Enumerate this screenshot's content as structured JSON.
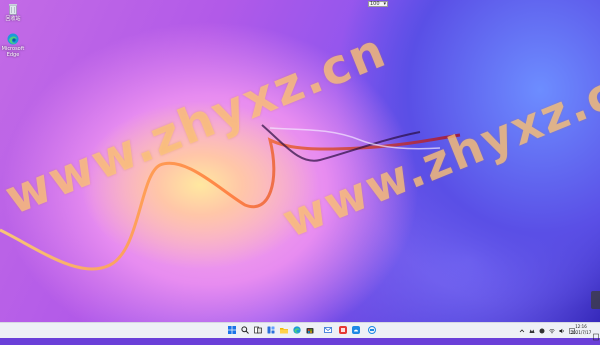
{
  "desktop": {
    "icons": [
      {
        "label": "回收站",
        "icon": "recycle-bin-icon"
      },
      {
        "label": "Microsoft Edge",
        "icon": "edge-icon"
      }
    ],
    "watermarks": [
      "www.zhyxz.cn",
      "www.zhyxz.cn"
    ]
  },
  "top_widget": {
    "value": "100"
  },
  "taskbar": {
    "apps": [
      {
        "name": "start-icon",
        "color": "#1a73e8"
      },
      {
        "name": "search-icon",
        "color": "#222222"
      },
      {
        "name": "task-view-icon",
        "color": "#222222"
      },
      {
        "name": "widgets-icon",
        "color": "#2a6fdb"
      },
      {
        "name": "file-explorer-icon",
        "color": "#f2b705"
      },
      {
        "name": "edge-icon",
        "color": "#1c9bd8"
      },
      {
        "name": "store-icon",
        "color": "#3a3a3a"
      },
      {
        "name": "mail-icon",
        "color": "#2b6fd6"
      },
      {
        "name": "app-red-icon",
        "color": "#e53935"
      },
      {
        "name": "app-blue-icon",
        "color": "#1e88e5"
      },
      {
        "name": "app-teal-icon",
        "color": "#1e88e5"
      }
    ],
    "tray": {
      "time": "12:16",
      "date": "2021/7/17"
    }
  }
}
